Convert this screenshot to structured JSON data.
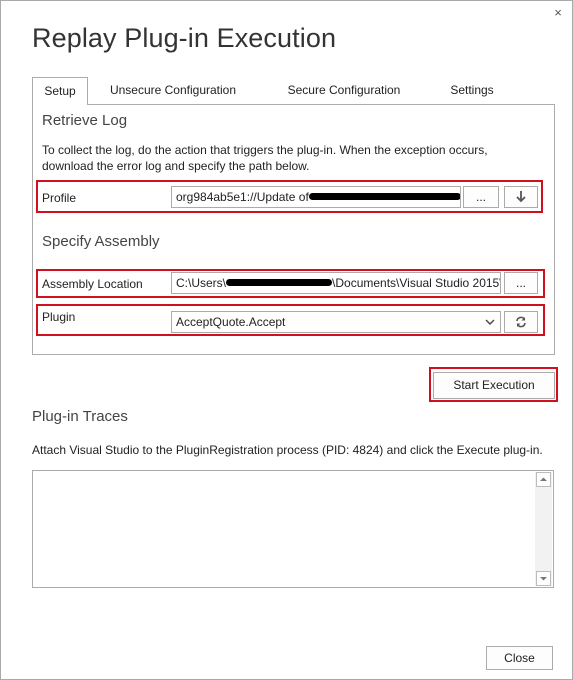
{
  "window": {
    "title": "Replay Plug-in Execution",
    "close_glyph": "×"
  },
  "tabs": [
    {
      "label": "Setup",
      "active": true
    },
    {
      "label": "Unsecure Configuration",
      "active": false
    },
    {
      "label": "Secure Configuration",
      "active": false
    },
    {
      "label": "Settings",
      "active": false
    }
  ],
  "setup": {
    "retrieve_log_title": "Retrieve Log",
    "retrieve_log_desc_line1": "To collect the log, do the action that triggers the plug-in. When the exception occurs,",
    "retrieve_log_desc_line2": "download the error log and specify the path below.",
    "profile_label": "Profile",
    "profile_value": "org984ab5e1://Update of",
    "browse_label": "...",
    "download_icon": "arrow-down-icon",
    "specify_assembly_title": "Specify Assembly",
    "assembly_label": "Assembly Location",
    "assembly_value_prefix": "C:\\Users\\",
    "assembly_value_suffix": "\\Documents\\Visual Studio 2015\\",
    "plugin_label": "Plugin",
    "plugin_value": "AcceptQuote.Accept",
    "refresh_icon": "refresh-icon"
  },
  "start_execution_label": "Start Execution",
  "traces": {
    "title": "Plug-in Traces",
    "description": "Attach Visual Studio to the PluginRegistration process (PID: 4824) and click the Execute plug-in."
  },
  "footer": {
    "close_label": "Close"
  },
  "colors": {
    "highlight_red": "#d0101e",
    "border_gray": "#acacac"
  }
}
